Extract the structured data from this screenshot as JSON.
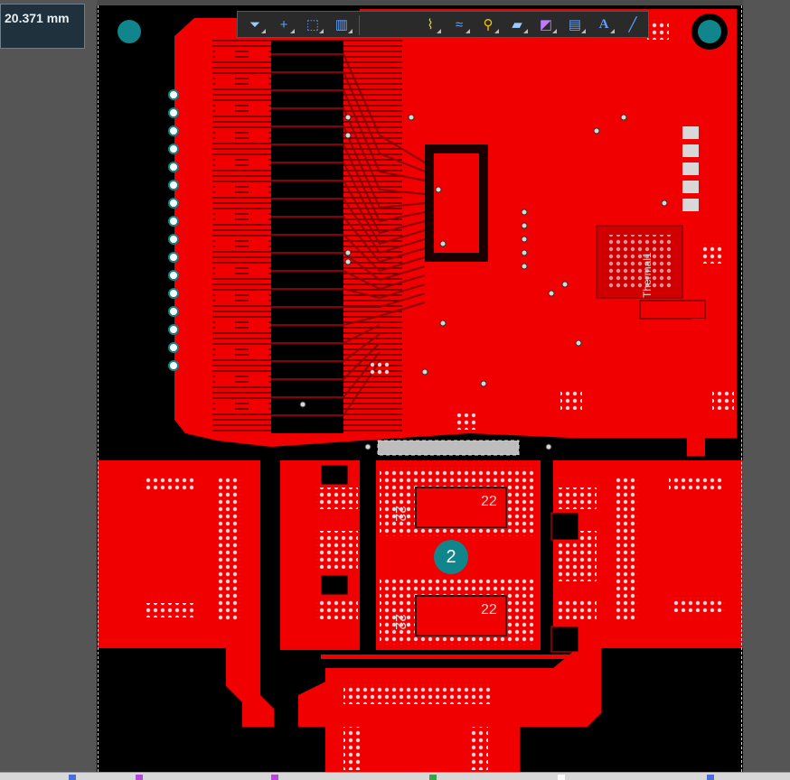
{
  "measurement": {
    "value": "20.371 mm"
  },
  "toolbar": {
    "tools": [
      {
        "name": "filter-icon",
        "glyph": "⏷"
      },
      {
        "name": "crosshair-icon",
        "glyph": "+"
      },
      {
        "name": "select-rect-icon",
        "glyph": "⬚"
      },
      {
        "name": "align-icon",
        "glyph": "▥"
      },
      {
        "name": "route-icon",
        "glyph": "⌇"
      },
      {
        "name": "tune-length-icon",
        "glyph": "≈"
      },
      {
        "name": "via-icon",
        "glyph": "⚲"
      },
      {
        "name": "fill-icon",
        "glyph": "▰"
      },
      {
        "name": "polygon-icon",
        "glyph": "◩"
      },
      {
        "name": "component-icon",
        "glyph": "▤"
      },
      {
        "name": "text-icon",
        "glyph": "A"
      },
      {
        "name": "line-icon",
        "glyph": "╱"
      }
    ]
  },
  "board": {
    "designator_label": "2",
    "silk_texts": [
      "22",
      "22",
      "22",
      "22",
      "Thermal1"
    ],
    "colors": {
      "copper": "#f00000",
      "background": "#000000",
      "pad": "#d8d8d8",
      "hole": "#10858b",
      "trace": "#8c0000"
    }
  }
}
